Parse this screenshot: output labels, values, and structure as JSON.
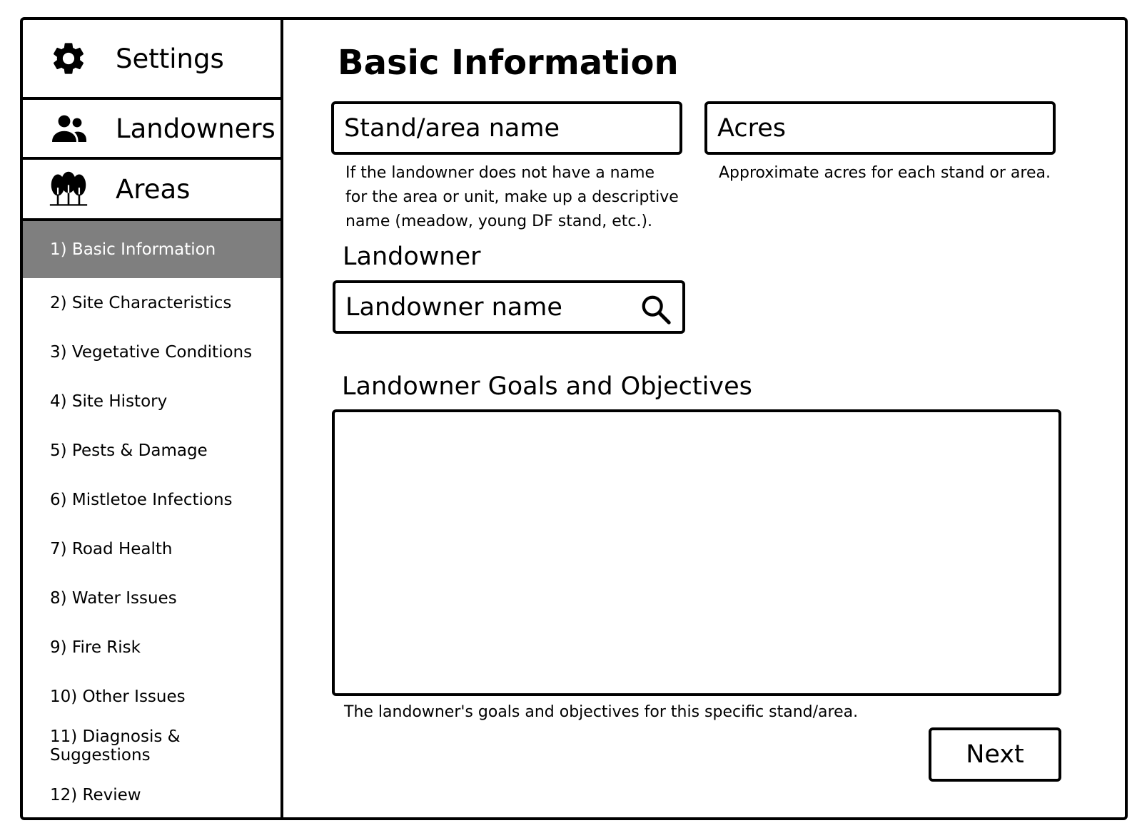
{
  "sidebar": {
    "settings": {
      "label": "Settings",
      "icon": "gear-icon"
    },
    "landowners": {
      "label": "Landowners",
      "icon": "people-icon"
    },
    "areas": {
      "label": "Areas",
      "icon": "trees-icon"
    },
    "steps": [
      {
        "label": "1) Basic Information",
        "active": true
      },
      {
        "label": "2) Site Characteristics"
      },
      {
        "label": "3) Vegetative Conditions"
      },
      {
        "label": "4) Site History"
      },
      {
        "label": "5) Pests & Damage"
      },
      {
        "label": "6) Mistletoe Infections"
      },
      {
        "label": "7) Road Health"
      },
      {
        "label": "8) Water Issues"
      },
      {
        "label": "9) Fire Risk"
      },
      {
        "label": "10) Other Issues"
      },
      {
        "label": "11) Diagnosis & Suggestions"
      },
      {
        "label": "12) Review"
      }
    ],
    "active_color": "#7f7f7f"
  },
  "main": {
    "title": "Basic Information",
    "stand_name": {
      "placeholder": "Stand/area name",
      "help": "If the landowner does not have a name for the area or unit, make up a descriptive name (meadow, young DF stand, etc.)."
    },
    "acres": {
      "placeholder": "Acres",
      "help": "Approximate acres for each stand or area."
    },
    "landowner": {
      "label": "Landowner",
      "placeholder": "Landowner name",
      "icon": "search-icon"
    },
    "goals": {
      "label": "Landowner Goals and Objectives",
      "value": "",
      "help": "The landowner's goals and objectives for this specific stand/area."
    },
    "next_label": "Next"
  }
}
